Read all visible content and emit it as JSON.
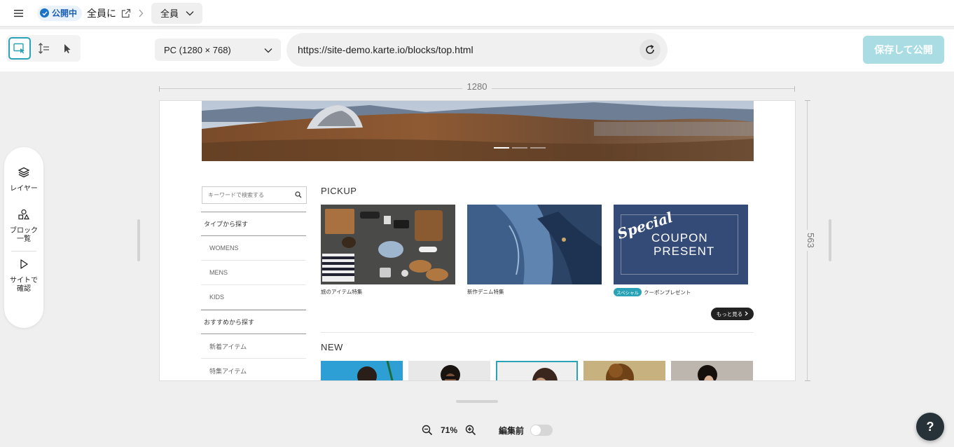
{
  "topbar": {
    "status_label": "公開中",
    "segment_title": "全員に",
    "segment_dropdown": "全員"
  },
  "toolbar": {
    "device_label": "PC (1280 × 768)",
    "url_value": "https://site-demo.karte.io/blocks/top.html",
    "publish_label": "保存して公開"
  },
  "side_panel": {
    "items": [
      {
        "label": "レイヤー",
        "icon": "layers-icon"
      },
      {
        "label": "ブロック\n一覧",
        "icon": "blocks-icon"
      },
      {
        "label": "サイトで\n確認",
        "icon": "play-icon"
      }
    ]
  },
  "canvas": {
    "width_label": "1280",
    "height_label": "563"
  },
  "preview": {
    "search_placeholder": "キーワードで検索する",
    "category_type_heading": "タイプから探す",
    "categories": [
      "WOMENS",
      "MENS",
      "KIDS"
    ],
    "category_reco_heading": "おすすめから探す",
    "reco_items": [
      "新着アイテム",
      "特集アイテム"
    ],
    "pickup_title": "PICKUP",
    "pickup": [
      {
        "caption": "旅のアイテム特集"
      },
      {
        "caption": "新作デニム特集"
      },
      {
        "badge": "スペシャル",
        "caption": "クーポンプレゼント",
        "banner_script": "Special",
        "banner_line1": "COUPON",
        "banner_line2": "PRESENT"
      }
    ],
    "more_label": "もっと見る",
    "new_title": "NEW"
  },
  "bottom": {
    "zoom_label": "71%",
    "before_edit_label": "編集前",
    "help_label": "?"
  },
  "colors": {
    "accent": "#29a3b5",
    "publish_disabled": "#a9dde3",
    "status_blue": "#1a73c9",
    "coupon_navy": "#354b77"
  }
}
